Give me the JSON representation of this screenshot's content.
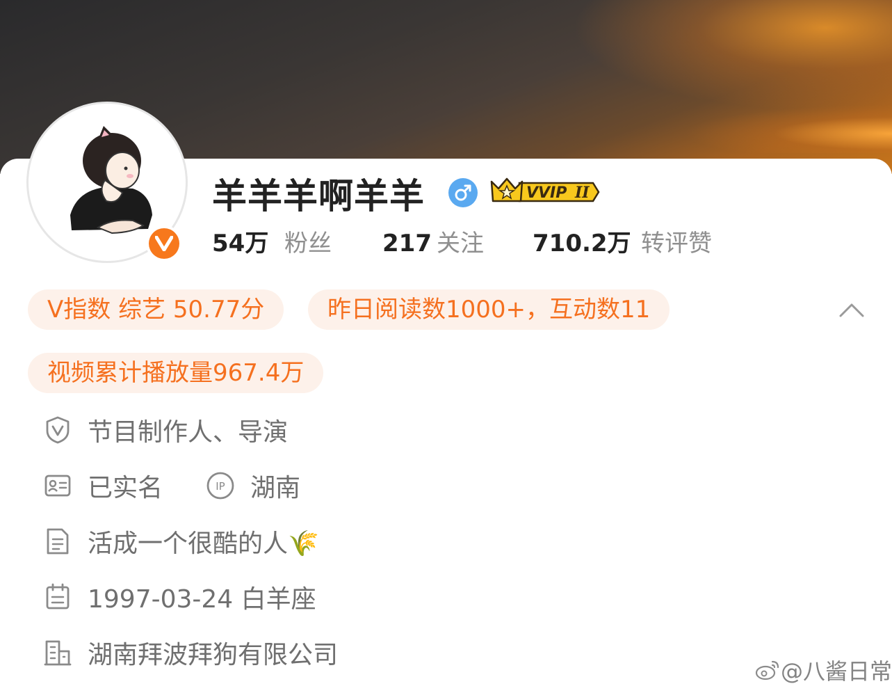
{
  "profile": {
    "username": "羊羊羊啊羊羊",
    "gender_icon": "male-icon",
    "verified_badge": "V",
    "vvip_label": "VVIP",
    "vvip_level": "II"
  },
  "stats": [
    {
      "number": "54万",
      "label": "粉丝"
    },
    {
      "number": "217",
      "label": "关注"
    },
    {
      "number": "710.2万",
      "label": "转评赞"
    }
  ],
  "tags": {
    "v_index": "V指数 综艺 50.77分",
    "reads": "昨日阅读数1000+，互动数11",
    "video_plays": "视频累计播放量967.4万"
  },
  "info": {
    "verification": "节目制作人、导演",
    "real_name": "已实名",
    "ip_icon_text": "IP",
    "ip_location": "湖南",
    "bio": "活成一个很酷的人🌾",
    "birthday": "1997-03-24 白羊座",
    "company": "湖南拜波拜狗有限公司"
  },
  "watermark": "@八酱日常",
  "colors": {
    "accent_orange": "#f5701f",
    "pill_bg": "#fdf1ea",
    "gender_blue": "#5aa9f0",
    "verified_orange": "#f7781c"
  }
}
